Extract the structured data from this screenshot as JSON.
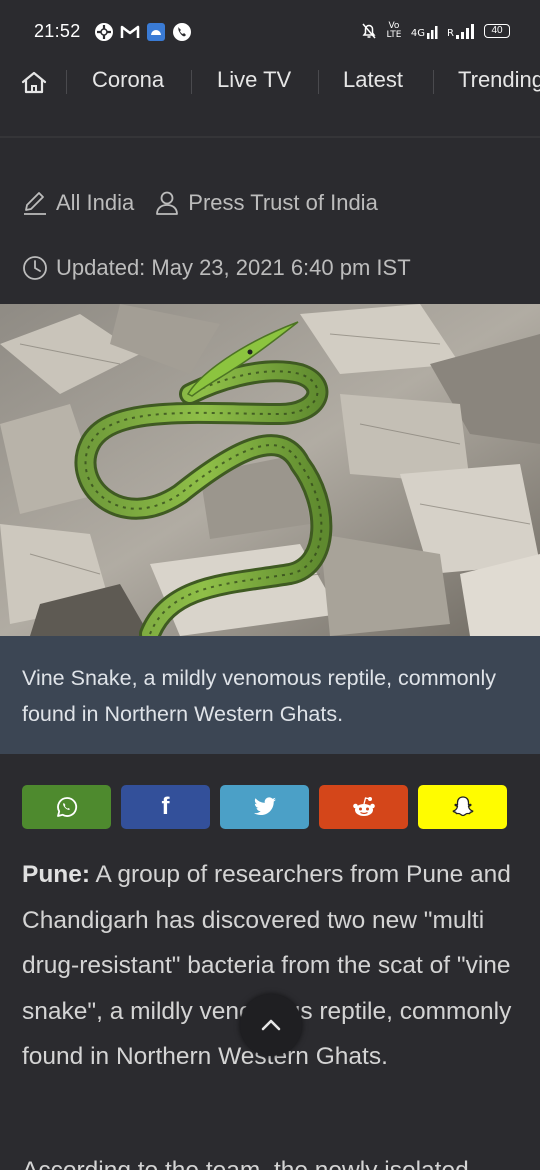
{
  "status_bar": {
    "time": "21:52",
    "network_label": "4G",
    "battery": "40",
    "volte_label": "Vo LTE",
    "roaming_label": "R"
  },
  "nav": {
    "items": [
      "Corona",
      "Live TV",
      "Latest",
      "Trending"
    ]
  },
  "meta": {
    "category": "All India",
    "author": "Press Trust of India",
    "updated": "Updated: May 23, 2021 6:40 pm IST"
  },
  "hero": {
    "caption": "Vine Snake, a mildly venomous reptile, commonly found in Northern Western Ghats."
  },
  "share": {
    "buttons": [
      {
        "name": "whatsapp",
        "color": "#4e8a2e"
      },
      {
        "name": "facebook",
        "color": "#33509a"
      },
      {
        "name": "twitter",
        "color": "#4ba0c7"
      },
      {
        "name": "reddit",
        "color": "#d4461a"
      },
      {
        "name": "snapchat",
        "color": "#fffc00"
      }
    ],
    "facebook_glyph": "f"
  },
  "article": {
    "dateline": "Pune:",
    "paragraph1": " A group of researchers from Pune and Chandigarh has discovered two new \"multi drug-resistant\" bacteria from the scat of \"vine snake\", a mildly venomous reptile, commonly found in Northern Western Ghats.",
    "paragraph2_start": "According to the team, the newly isolated"
  },
  "colors": {
    "background": "#2b2b2f",
    "caption_bg": "#3c4654"
  }
}
